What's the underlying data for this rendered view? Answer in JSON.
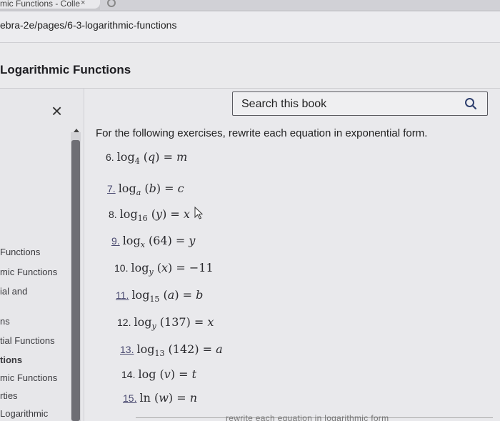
{
  "browser": {
    "tab_title": "mic Functions - Colle",
    "tab_close": "×",
    "url": "ebra-2e/pages/6-3-logarithmic-functions"
  },
  "header": {
    "book_title": "Logarithmic Functions"
  },
  "toc": {
    "close_label": "×",
    "items": [
      {
        "label": "Functions"
      },
      {
        "label": "mic Functions"
      },
      {
        "label": "ial and"
      },
      {
        "label": "ns"
      },
      {
        "label": "tial Functions"
      },
      {
        "label": "tions"
      },
      {
        "label": "mic Functions"
      },
      {
        "label": "rties"
      },
      {
        "label": "Logarithmic"
      }
    ]
  },
  "search": {
    "placeholder": "Search this book",
    "icon": "search-icon"
  },
  "content": {
    "intro": "For the following exercises, rewrite each equation in exponential form.",
    "bottom_partial": "rewrite each equation in logarithmic form",
    "exercises": [
      {
        "num": "6.",
        "base": "log",
        "sub": "4",
        "arg": "q",
        "rhs": "m",
        "linked": false
      },
      {
        "num": "7.",
        "base": "log",
        "sub": "a",
        "arg": "b",
        "rhs": "c",
        "linked": true
      },
      {
        "num": "8.",
        "base": "log",
        "sub": "16",
        "arg": "y",
        "rhs": "x",
        "linked": false
      },
      {
        "num": "9.",
        "base": "log",
        "sub": "x",
        "arg": "64",
        "rhs": "y",
        "linked": true
      },
      {
        "num": "10.",
        "base": "log",
        "sub": "y",
        "arg": "x",
        "rhs": "−11",
        "linked": false
      },
      {
        "num": "11.",
        "base": "log",
        "sub": "15",
        "arg": "a",
        "rhs": "b",
        "linked": true
      },
      {
        "num": "12.",
        "base": "log",
        "sub": "y",
        "arg": "137",
        "rhs": "x",
        "linked": false
      },
      {
        "num": "13.",
        "base": "log",
        "sub": "13",
        "arg": "142",
        "rhs": "a",
        "linked": true
      },
      {
        "num": "14.",
        "base": "log",
        "sub": "",
        "arg": "v",
        "rhs": "t",
        "linked": false
      },
      {
        "num": "15.",
        "base": "ln",
        "sub": "",
        "arg": "w",
        "rhs": "n",
        "linked": true
      }
    ]
  },
  "colors": {
    "background": "#e9e9ec",
    "text": "#2a2a2e",
    "link": "#4a4a70"
  }
}
